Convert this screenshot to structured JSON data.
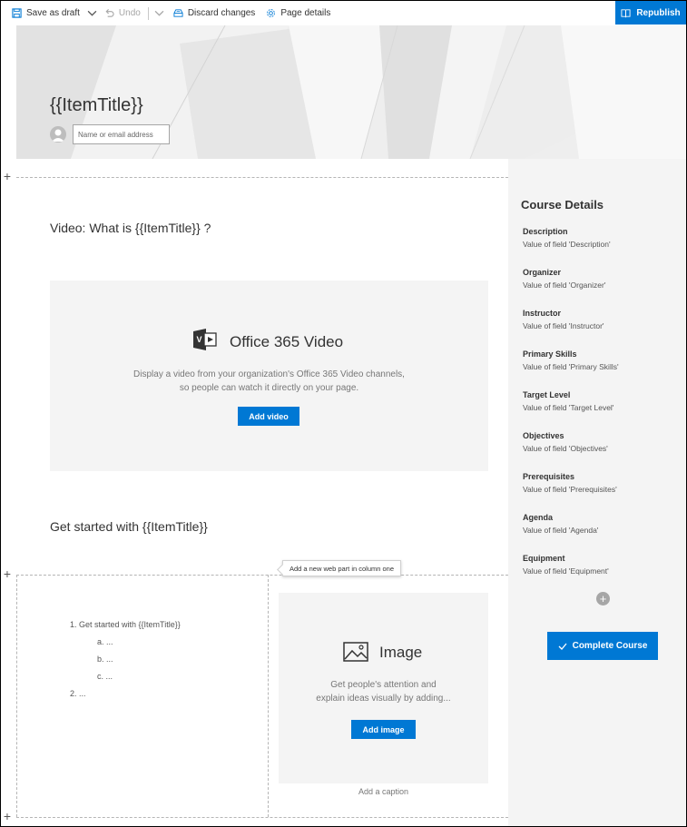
{
  "toolbar": {
    "save_label": "Save as draft",
    "undo_label": "Undo",
    "discard_label": "Discard changes",
    "details_label": "Page details",
    "republish_label": "Republish"
  },
  "hero": {
    "title": "{{ItemTitle}}",
    "author_placeholder": "Name or email address"
  },
  "section1": {
    "heading": "Video: What is {{ItemTitle}} ?",
    "video": {
      "title": "Office 365 Video",
      "desc_line1": "Display a video from your organization's Office 365 Video channels,",
      "desc_line2": "so people can watch it directly on your page.",
      "button": "Add video"
    },
    "heading2": "Get started with {{ItemTitle}}"
  },
  "tooltip": "Add a new web part in column one",
  "list": {
    "item1": "1. Get started with {{ItemTitle}}",
    "item1a": "a.  ...",
    "item1b": "b.  ...",
    "item1c": "c.  ...",
    "item2": "2. ..."
  },
  "image": {
    "title": "Image",
    "desc_line1": "Get people's attention and",
    "desc_line2": "explain ideas visually by adding...",
    "button": "Add image",
    "caption": "Add a caption"
  },
  "sidebar": {
    "title": "Course Details",
    "fields": [
      {
        "label": "Description",
        "value": "Value of field 'Description'"
      },
      {
        "label": "Organizer",
        "value": "Value of field 'Organizer'"
      },
      {
        "label": "Instructor",
        "value": "Value of field 'Instructor'"
      },
      {
        "label": "Primary Skills",
        "value": "Value of field 'Primary Skills'"
      },
      {
        "label": "Target Level",
        "value": "Value of field 'Target Level'"
      },
      {
        "label": "Objectives",
        "value": "Value of field 'Objectives'"
      },
      {
        "label": "Prerequisites",
        "value": "Value of field 'Prerequisites'"
      },
      {
        "label": "Agenda",
        "value": "Value of field 'Agenda'"
      },
      {
        "label": "Equipment",
        "value": "Value of field 'Equipment'"
      }
    ],
    "complete_button": "Complete Course"
  },
  "colors": {
    "accent": "#0078d4",
    "panel": "#f4f4f4",
    "text": "#333333"
  }
}
